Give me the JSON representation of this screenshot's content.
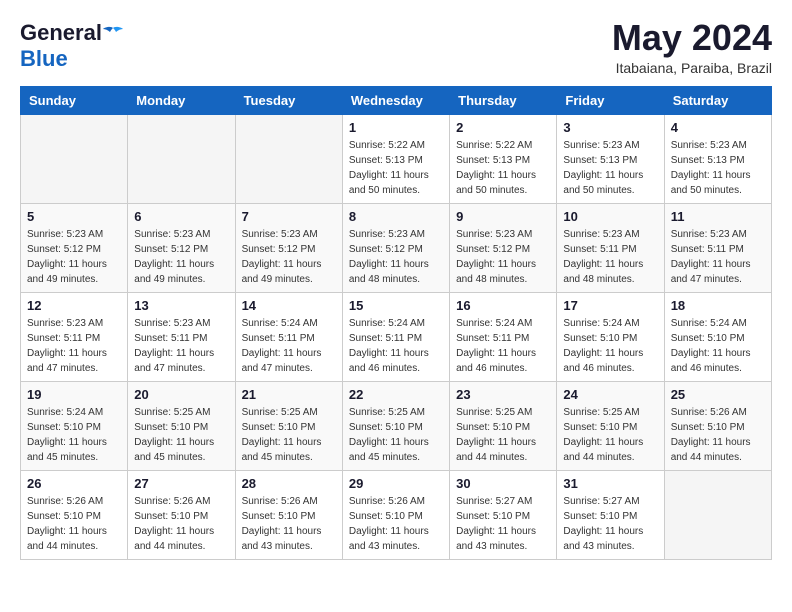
{
  "header": {
    "logo": {
      "line1": "General",
      "line2": "Blue",
      "tagline": ""
    },
    "title": "May 2024",
    "location": "Itabaiana, Paraiba, Brazil"
  },
  "weekdays": [
    "Sunday",
    "Monday",
    "Tuesday",
    "Wednesday",
    "Thursday",
    "Friday",
    "Saturday"
  ],
  "weeks": [
    [
      {
        "day": "",
        "sunrise": "",
        "sunset": "",
        "daylight": ""
      },
      {
        "day": "",
        "sunrise": "",
        "sunset": "",
        "daylight": ""
      },
      {
        "day": "",
        "sunrise": "",
        "sunset": "",
        "daylight": ""
      },
      {
        "day": "1",
        "sunrise": "Sunrise: 5:22 AM",
        "sunset": "Sunset: 5:13 PM",
        "daylight": "Daylight: 11 hours and 50 minutes."
      },
      {
        "day": "2",
        "sunrise": "Sunrise: 5:22 AM",
        "sunset": "Sunset: 5:13 PM",
        "daylight": "Daylight: 11 hours and 50 minutes."
      },
      {
        "day": "3",
        "sunrise": "Sunrise: 5:23 AM",
        "sunset": "Sunset: 5:13 PM",
        "daylight": "Daylight: 11 hours and 50 minutes."
      },
      {
        "day": "4",
        "sunrise": "Sunrise: 5:23 AM",
        "sunset": "Sunset: 5:13 PM",
        "daylight": "Daylight: 11 hours and 50 minutes."
      }
    ],
    [
      {
        "day": "5",
        "sunrise": "Sunrise: 5:23 AM",
        "sunset": "Sunset: 5:12 PM",
        "daylight": "Daylight: 11 hours and 49 minutes."
      },
      {
        "day": "6",
        "sunrise": "Sunrise: 5:23 AM",
        "sunset": "Sunset: 5:12 PM",
        "daylight": "Daylight: 11 hours and 49 minutes."
      },
      {
        "day": "7",
        "sunrise": "Sunrise: 5:23 AM",
        "sunset": "Sunset: 5:12 PM",
        "daylight": "Daylight: 11 hours and 49 minutes."
      },
      {
        "day": "8",
        "sunrise": "Sunrise: 5:23 AM",
        "sunset": "Sunset: 5:12 PM",
        "daylight": "Daylight: 11 hours and 48 minutes."
      },
      {
        "day": "9",
        "sunrise": "Sunrise: 5:23 AM",
        "sunset": "Sunset: 5:12 PM",
        "daylight": "Daylight: 11 hours and 48 minutes."
      },
      {
        "day": "10",
        "sunrise": "Sunrise: 5:23 AM",
        "sunset": "Sunset: 5:11 PM",
        "daylight": "Daylight: 11 hours and 48 minutes."
      },
      {
        "day": "11",
        "sunrise": "Sunrise: 5:23 AM",
        "sunset": "Sunset: 5:11 PM",
        "daylight": "Daylight: 11 hours and 47 minutes."
      }
    ],
    [
      {
        "day": "12",
        "sunrise": "Sunrise: 5:23 AM",
        "sunset": "Sunset: 5:11 PM",
        "daylight": "Daylight: 11 hours and 47 minutes."
      },
      {
        "day": "13",
        "sunrise": "Sunrise: 5:23 AM",
        "sunset": "Sunset: 5:11 PM",
        "daylight": "Daylight: 11 hours and 47 minutes."
      },
      {
        "day": "14",
        "sunrise": "Sunrise: 5:24 AM",
        "sunset": "Sunset: 5:11 PM",
        "daylight": "Daylight: 11 hours and 47 minutes."
      },
      {
        "day": "15",
        "sunrise": "Sunrise: 5:24 AM",
        "sunset": "Sunset: 5:11 PM",
        "daylight": "Daylight: 11 hours and 46 minutes."
      },
      {
        "day": "16",
        "sunrise": "Sunrise: 5:24 AM",
        "sunset": "Sunset: 5:11 PM",
        "daylight": "Daylight: 11 hours and 46 minutes."
      },
      {
        "day": "17",
        "sunrise": "Sunrise: 5:24 AM",
        "sunset": "Sunset: 5:10 PM",
        "daylight": "Daylight: 11 hours and 46 minutes."
      },
      {
        "day": "18",
        "sunrise": "Sunrise: 5:24 AM",
        "sunset": "Sunset: 5:10 PM",
        "daylight": "Daylight: 11 hours and 46 minutes."
      }
    ],
    [
      {
        "day": "19",
        "sunrise": "Sunrise: 5:24 AM",
        "sunset": "Sunset: 5:10 PM",
        "daylight": "Daylight: 11 hours and 45 minutes."
      },
      {
        "day": "20",
        "sunrise": "Sunrise: 5:25 AM",
        "sunset": "Sunset: 5:10 PM",
        "daylight": "Daylight: 11 hours and 45 minutes."
      },
      {
        "day": "21",
        "sunrise": "Sunrise: 5:25 AM",
        "sunset": "Sunset: 5:10 PM",
        "daylight": "Daylight: 11 hours and 45 minutes."
      },
      {
        "day": "22",
        "sunrise": "Sunrise: 5:25 AM",
        "sunset": "Sunset: 5:10 PM",
        "daylight": "Daylight: 11 hours and 45 minutes."
      },
      {
        "day": "23",
        "sunrise": "Sunrise: 5:25 AM",
        "sunset": "Sunset: 5:10 PM",
        "daylight": "Daylight: 11 hours and 44 minutes."
      },
      {
        "day": "24",
        "sunrise": "Sunrise: 5:25 AM",
        "sunset": "Sunset: 5:10 PM",
        "daylight": "Daylight: 11 hours and 44 minutes."
      },
      {
        "day": "25",
        "sunrise": "Sunrise: 5:26 AM",
        "sunset": "Sunset: 5:10 PM",
        "daylight": "Daylight: 11 hours and 44 minutes."
      }
    ],
    [
      {
        "day": "26",
        "sunrise": "Sunrise: 5:26 AM",
        "sunset": "Sunset: 5:10 PM",
        "daylight": "Daylight: 11 hours and 44 minutes."
      },
      {
        "day": "27",
        "sunrise": "Sunrise: 5:26 AM",
        "sunset": "Sunset: 5:10 PM",
        "daylight": "Daylight: 11 hours and 44 minutes."
      },
      {
        "day": "28",
        "sunrise": "Sunrise: 5:26 AM",
        "sunset": "Sunset: 5:10 PM",
        "daylight": "Daylight: 11 hours and 43 minutes."
      },
      {
        "day": "29",
        "sunrise": "Sunrise: 5:26 AM",
        "sunset": "Sunset: 5:10 PM",
        "daylight": "Daylight: 11 hours and 43 minutes."
      },
      {
        "day": "30",
        "sunrise": "Sunrise: 5:27 AM",
        "sunset": "Sunset: 5:10 PM",
        "daylight": "Daylight: 11 hours and 43 minutes."
      },
      {
        "day": "31",
        "sunrise": "Sunrise: 5:27 AM",
        "sunset": "Sunset: 5:10 PM",
        "daylight": "Daylight: 11 hours and 43 minutes."
      },
      {
        "day": "",
        "sunrise": "",
        "sunset": "",
        "daylight": ""
      }
    ]
  ]
}
